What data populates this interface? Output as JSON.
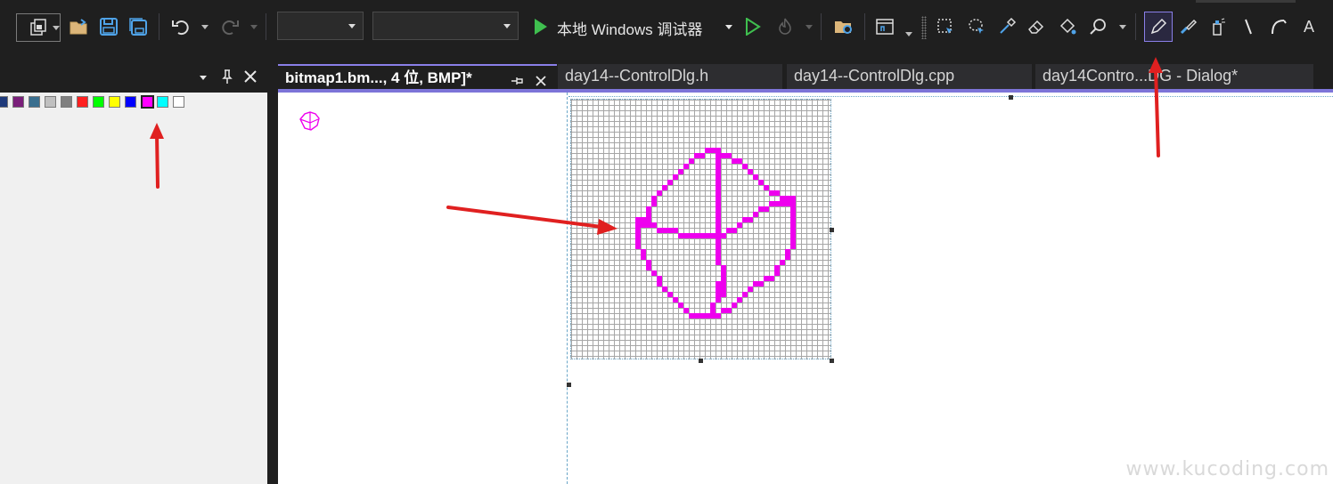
{
  "toolbar": {
    "debug_target": "本地 Windows 调试器",
    "config_dropdown_value": "",
    "platform_dropdown_value": "",
    "text_tool_label": "A"
  },
  "palette": {
    "colors": [
      "#1f3a7a",
      "#7a1f7a",
      "#3a6f8f",
      "#c0c0c0",
      "#808080",
      "#ff2020",
      "#00ff00",
      "#ffff00",
      "#0000ff",
      "#ff00ff",
      "#00ffff",
      "#ffffff"
    ],
    "selected_color": "#ff00ff"
  },
  "tabs": [
    {
      "label": "bitmap1.bm..., 4 位, BMP]*",
      "active": true
    },
    {
      "label": "day14--ControlDlg.h",
      "active": false
    },
    {
      "label": "day14--ControlDlg.cpp",
      "active": false
    },
    {
      "label": "day14Contro...DG - Dialog*",
      "active": false
    }
  ],
  "editor": {
    "bitmap_pixels": 48,
    "draw_color": "#ee00ee"
  },
  "watermark": "www.kucoding.com",
  "colors": {
    "accent": "#7d74d8",
    "annotation_arrow": "#e02020",
    "toolbar_bg": "#1f1f1f"
  }
}
